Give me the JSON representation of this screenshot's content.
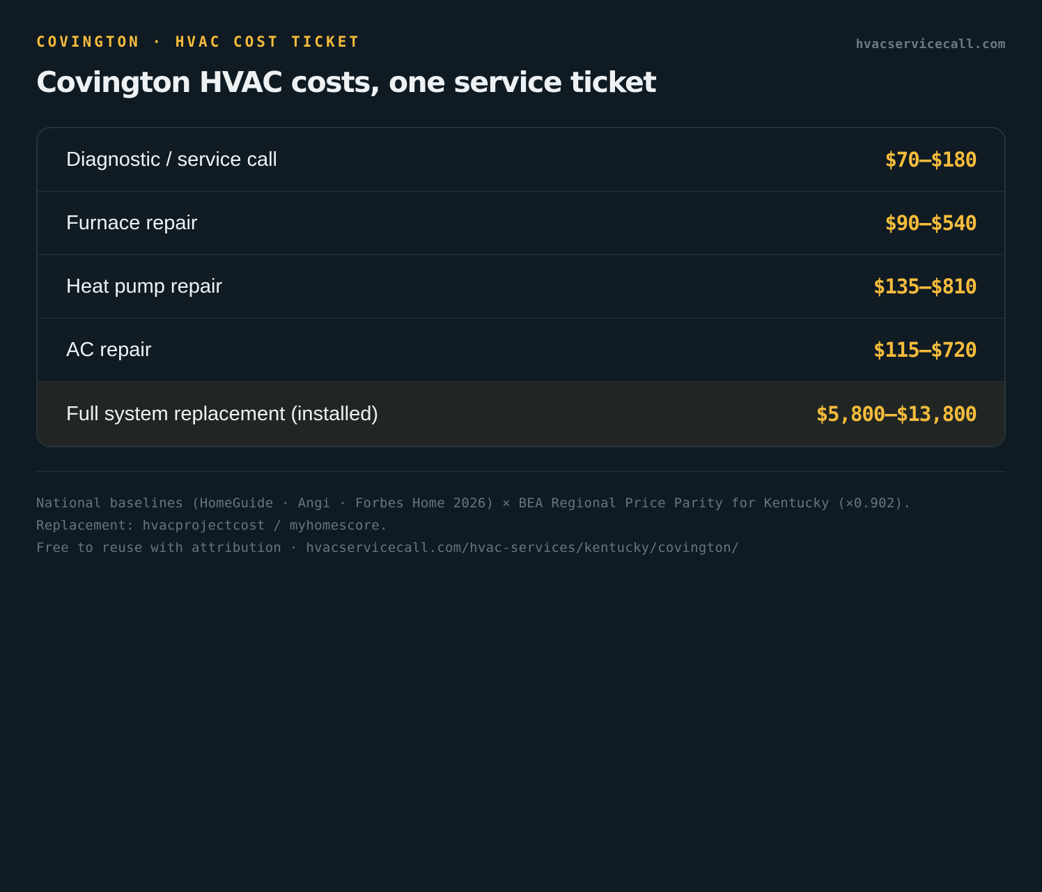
{
  "header": {
    "kicker": "COVINGTON · HVAC COST TICKET",
    "site": "hvacservicecall.com",
    "title": "Covington HVAC costs, one service ticket"
  },
  "ticket": {
    "rows": [
      {
        "label": "Diagnostic / service call",
        "price": "$70–$180",
        "highlight": false
      },
      {
        "label": "Furnace repair",
        "price": "$90–$540",
        "highlight": false
      },
      {
        "label": "Heat pump repair",
        "price": "$135–$810",
        "highlight": false
      },
      {
        "label": "AC repair",
        "price": "$115–$720",
        "highlight": false
      },
      {
        "label": "Full system replacement (installed)",
        "price": "$5,800–$13,800",
        "highlight": true
      }
    ]
  },
  "footer": {
    "lines": [
      "National baselines (HomeGuide · Angi · Forbes Home 2026) × BEA Regional Price Parity for Kentucky (×0.902).",
      "Replacement: hvacprojectcost / myhomescore.",
      "Free to reuse with attribution · hvacservicecall.com/hvac-services/kentucky/covington/"
    ]
  },
  "colors": {
    "background": "#0f1a22",
    "accent": "#f5bc3c",
    "text": "#eef1f4",
    "muted": "#687580",
    "highlight_row": "#212624"
  }
}
